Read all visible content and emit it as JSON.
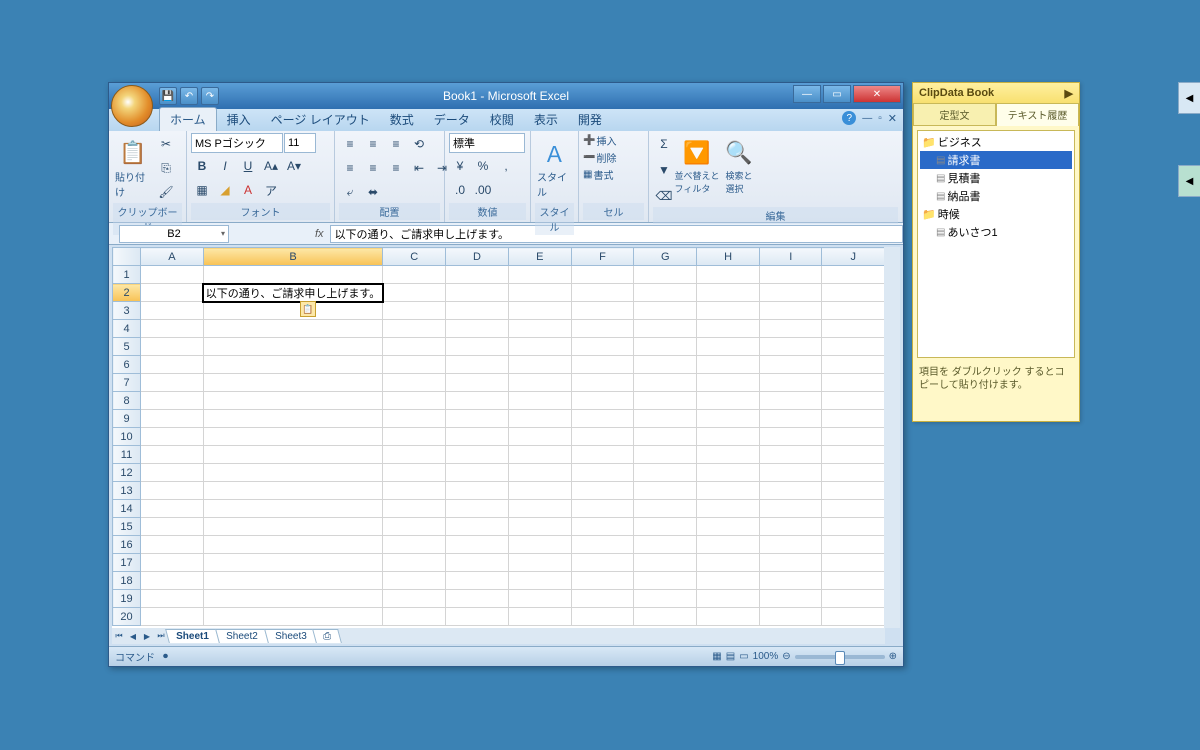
{
  "window": {
    "title": "Book1 - Microsoft Excel"
  },
  "tabs": {
    "home": "ホーム",
    "insert": "挿入",
    "pagelayout": "ページ レイアウト",
    "formulas": "数式",
    "data": "データ",
    "review": "校閲",
    "view": "表示",
    "dev": "開発"
  },
  "ribbon": {
    "clipboard": {
      "label": "クリップボード",
      "paste": "貼り付け"
    },
    "font": {
      "label": "フォント",
      "name": "MS Pゴシック",
      "size": "11"
    },
    "align": {
      "label": "配置"
    },
    "number": {
      "label": "数値",
      "format": "標準"
    },
    "style": {
      "label": "スタイル",
      "btn": "スタイル"
    },
    "cells": {
      "label": "セル",
      "insert": "挿入",
      "delete": "削除",
      "format": "書式"
    },
    "edit": {
      "label": "編集",
      "sort": "並べ替えと\nフィルタ",
      "find": "検索と\n選択"
    }
  },
  "formula": {
    "cell": "B2",
    "value": "以下の通り、ご請求申し上げます。"
  },
  "grid": {
    "cols": [
      "A",
      "B",
      "C",
      "D",
      "E",
      "F",
      "G",
      "H",
      "I",
      "J"
    ],
    "rows": [
      "1",
      "2",
      "3",
      "4",
      "5",
      "6",
      "7",
      "8",
      "9",
      "10",
      "11",
      "12",
      "13",
      "14",
      "15",
      "16",
      "17",
      "18",
      "19",
      "20"
    ],
    "b2": "以下の通り、ご請求申し上げます。"
  },
  "sheets": {
    "s1": "Sheet1",
    "s2": "Sheet2",
    "s3": "Sheet3"
  },
  "status": {
    "left": "コマンド",
    "zoom": "100%"
  },
  "sidebar": {
    "title": "ClipData Book",
    "tab1": "定型文",
    "tab2": "テキスト履歴",
    "folder1": "ビジネス",
    "items1": [
      "請求書",
      "見積書",
      "納品書"
    ],
    "folder2": "時候",
    "items2": [
      "あいさつ1"
    ],
    "hint": "項目を ダブルクリック するとコピーして貼り付けます。"
  }
}
